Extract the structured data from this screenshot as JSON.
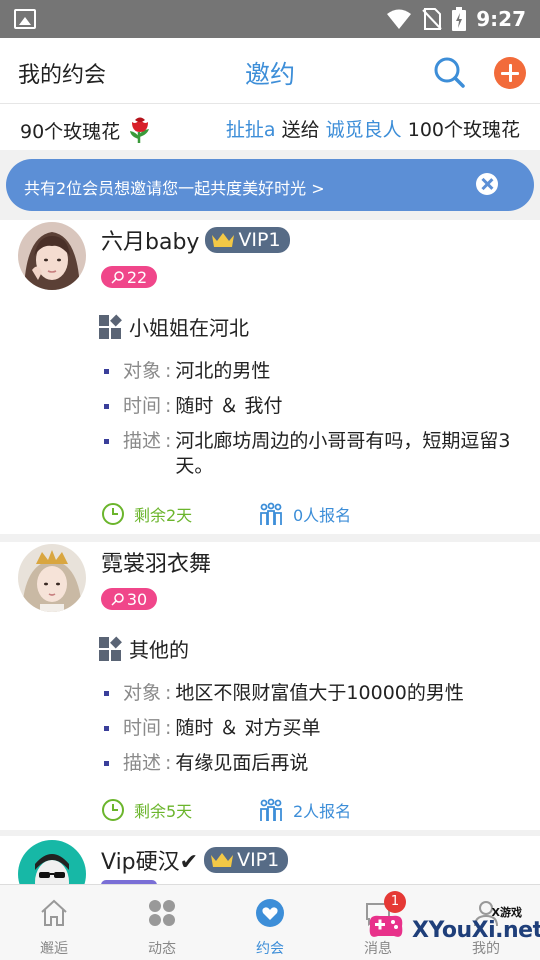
{
  "statusbar": {
    "time": "9:27"
  },
  "header": {
    "left_title": "我的约会",
    "center_title": "邀约"
  },
  "ticker": {
    "left_text": "90个玫瑰花",
    "right_sender": "扯扯a",
    "right_verb": " 送给 ",
    "right_receiver": "诚觅良人",
    "right_amount": " 100个玫瑰花"
  },
  "invite_banner": {
    "text": "共有2位会员想邀请您一起共度美好时光 >"
  },
  "cards": [
    {
      "username": "六月baby",
      "vip": "VIP1",
      "roses": "22",
      "category": "小姐姐在河北",
      "details": [
        {
          "label": "对象",
          "sep": ":",
          "value": "河北的男性"
        },
        {
          "label": "时间",
          "sep": ":",
          "value": "随时 ＆ 我付"
        },
        {
          "label": "描述",
          "sep": ":",
          "value": "河北廊坊周边的小哥哥有吗，短期逗留3天。"
        }
      ],
      "remaining": "剩余2天",
      "signups": "0人报名"
    },
    {
      "username": "霓裳羽衣舞",
      "roses": "30",
      "category": "其他的",
      "details": [
        {
          "label": "对象",
          "sep": ":",
          "value": "地区不限财富值大于10000的男性"
        },
        {
          "label": "时间",
          "sep": ":",
          "value": "随时 ＆ 对方买单"
        },
        {
          "label": "描述",
          "sep": ":",
          "value": "有缘见面后再说"
        }
      ],
      "remaining": "剩余5天",
      "signups": "2人报名"
    },
    {
      "username": "Vip硬汉✔",
      "vip": "VIP1"
    }
  ],
  "tabbar": {
    "tabs": [
      {
        "label": "邂逅"
      },
      {
        "label": "动态"
      },
      {
        "label": "约会"
      },
      {
        "label": "消息",
        "badge": "1"
      },
      {
        "label": "我的"
      }
    ]
  },
  "watermark": {
    "top": "X游戏",
    "main": "XYouXi.net"
  },
  "colors": {
    "accent_blue": "#3d8ed8",
    "add_orange": "#f26b3a",
    "rose_pink": "#f0468a",
    "vip_slate": "#566b86",
    "remain_green": "#6bb52c",
    "banner_blue": "#5c8fd6"
  }
}
